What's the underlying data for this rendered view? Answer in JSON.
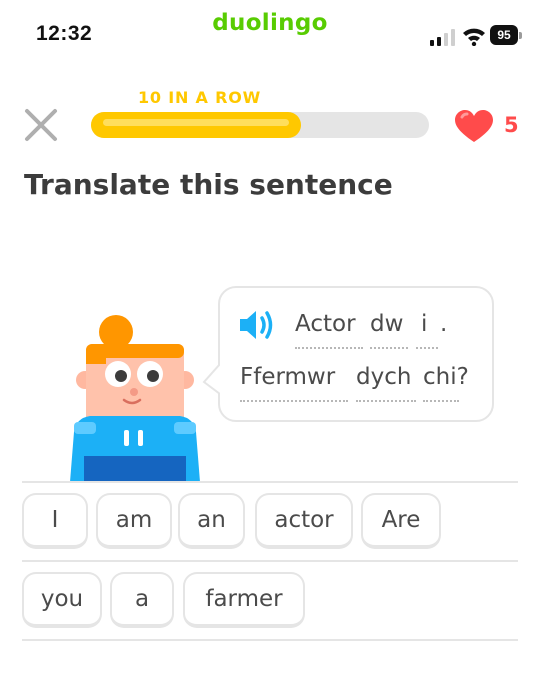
{
  "status_bar": {
    "time": "12:32",
    "battery": "95"
  },
  "brand": {
    "name": "duolingo"
  },
  "header": {
    "streak_label": "10 IN A ROW",
    "progress": 0.62,
    "hearts": "5"
  },
  "title": "Translate this sentence",
  "prompt": {
    "line1": [
      "Actor",
      "dw",
      "i",
      "."
    ],
    "line2": [
      "Ffermwr",
      "dych",
      "chi?"
    ]
  },
  "word_bank": {
    "row1": [
      "I",
      "am",
      "an",
      "actor",
      "Are"
    ],
    "row2": [
      "you",
      "a",
      "farmer"
    ]
  },
  "colors": {
    "green": "#58cc02",
    "gold": "#ffc800",
    "red": "#ff4b4b",
    "blue": "#1cb0f6"
  }
}
